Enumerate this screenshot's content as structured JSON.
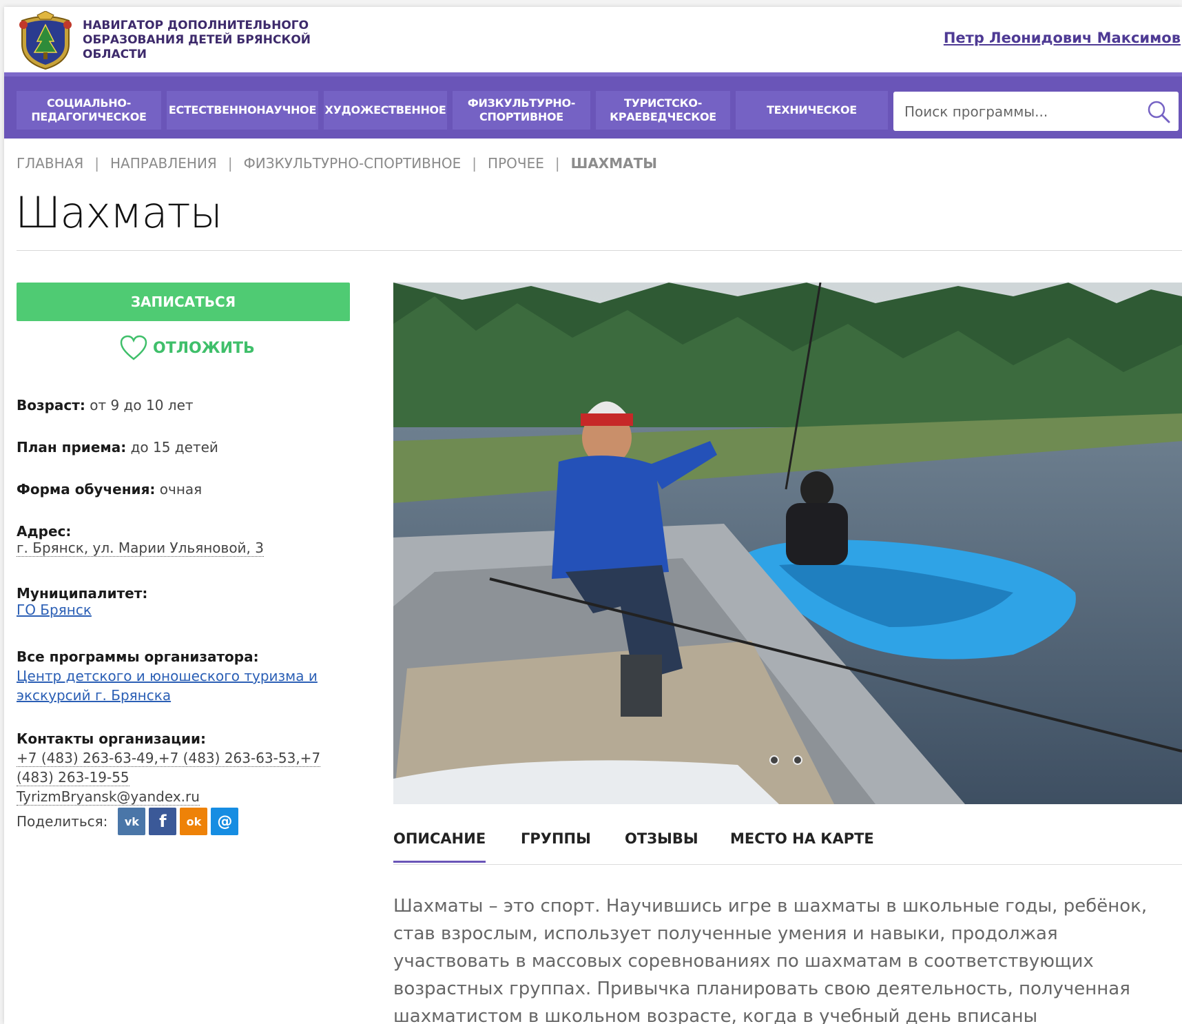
{
  "header": {
    "site_title": "НАВИГАТОР ДОПОЛНИТЕЛЬНОГО ОБРАЗОВАНИЯ ДЕТЕЙ БРЯНСКОЙ ОБЛАСТИ",
    "user_name": "Петр Леонидович Максимов"
  },
  "nav": {
    "items": [
      {
        "label": "СОЦИАЛЬНО-ПЕДАГОГИЧЕСКОЕ"
      },
      {
        "label": "ЕСТЕСТВЕННОНАУЧНОЕ"
      },
      {
        "label": "ХУДОЖЕСТВЕННОЕ"
      },
      {
        "label": "ФИЗКУЛЬТУРНО-СПОРТИВНОЕ"
      },
      {
        "label": "ТУРИСТСКО-КРАЕВЕДЧЕСКОЕ"
      },
      {
        "label": "ТЕХНИЧЕСКОЕ"
      }
    ],
    "search_placeholder": "Поиск программы..."
  },
  "breadcrumb": [
    "ГЛАВНАЯ",
    "НАПРАВЛЕНИЯ",
    "ФИЗКУЛЬТУРНО-СПОРТИВНОЕ",
    "ПРОЧЕЕ",
    "ШАХМАТЫ"
  ],
  "page_title": "Шахматы",
  "actions": {
    "enroll_label": "ЗАПИСАТЬСЯ",
    "postpone_label": "ОТЛОЖИТЬ"
  },
  "info": {
    "age_label": "Возраст:",
    "age_value": "от 9 до 10 лет",
    "plan_label": "План приема:",
    "plan_value": "до 15 детей",
    "form_label": "Форма обучения:",
    "form_value": "очная",
    "address_label": "Адрес:",
    "address_value": "г. Брянск, ул. Марии Ульяновой, 3",
    "municipality_label": "Муниципалитет:",
    "municipality_value": "ГО Брянск",
    "organizer_label": "Все программы организатора:",
    "organizer_value": "Центр детского и юношеского туризма и экскурсий г. Брянска",
    "contacts_label": "Контакты организации:",
    "contacts_phones": "+7 (483) 263-63-49,+7 (483) 263-63-53,+7 (483) 263-19-55",
    "contacts_email": "TyrizmBryansk@yandex.ru",
    "share_label": "Поделиться:"
  },
  "share": {
    "buttons": [
      {
        "icon": "vk-icon",
        "glyph": "vk",
        "color": "#4a76a8"
      },
      {
        "icon": "facebook-icon",
        "glyph": "f",
        "color": "#3b5998"
      },
      {
        "icon": "odnoklassniki-icon",
        "glyph": "ok",
        "color": "#ee8208"
      },
      {
        "icon": "moimir-icon",
        "glyph": "@",
        "color": "#168de2"
      }
    ]
  },
  "tabs": [
    {
      "label": "ОПИСАНИЕ",
      "active": true
    },
    {
      "label": "ГРУППЫ",
      "active": false
    },
    {
      "label": "ОТЗЫВЫ",
      "active": false
    },
    {
      "label": "МЕСТО НА КАРТЕ",
      "active": false
    }
  ],
  "description": "Шахматы – это спорт. Научившись игре в шахматы в школьные годы, ребёнок, став взрослым, использует полученные умения и навыки, продолжая участвовать в массовых соревнованиях по шахматам в соответствующих возрастных группах. Привычка планировать свою деятельность, полученная шахматистом в школьном возрасте, когда в учебный день вписаны",
  "colors": {
    "nav_bg": "#6a55b8",
    "accent_green": "#4fcb73",
    "link": "#2b5fb5"
  }
}
